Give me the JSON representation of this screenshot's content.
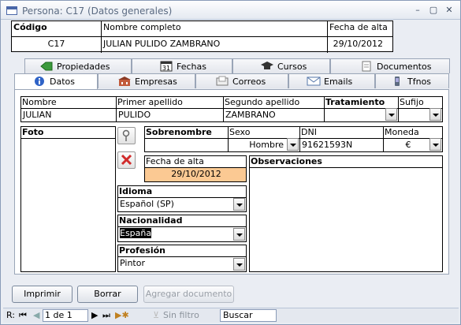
{
  "window": {
    "title": "Persona: C17 (Datos generales)",
    "controls": [
      "–",
      "▢",
      "✕"
    ]
  },
  "header": {
    "codigo_label": "Código",
    "codigo_value": "C17",
    "nombre_label": "Nombre completo",
    "nombre_value": "JULIAN PULIDO ZAMBRANO",
    "fecha_label": "Fecha de alta",
    "fecha_value": "29/10/2012"
  },
  "tabs_top": [
    {
      "label": "Propiedades",
      "icon": "tag-icon"
    },
    {
      "label": "Fechas",
      "icon": "calendar-icon",
      "badge": "31"
    },
    {
      "label": "Cursos",
      "icon": "graduation-cap-icon"
    },
    {
      "label": "Documentos",
      "icon": "document-icon"
    }
  ],
  "tabs_bottom": [
    {
      "label": "Datos",
      "icon": "info-icon"
    },
    {
      "label": "Empresas",
      "icon": "building-icon"
    },
    {
      "label": "Correos",
      "icon": "mail-tray-icon"
    },
    {
      "label": "Emails",
      "icon": "envelope-icon"
    },
    {
      "label": "Tfnos",
      "icon": "phone-icon"
    }
  ],
  "form": {
    "nombre_label": "Nombre",
    "nombre_value": "JULIAN",
    "apellido1_label": "Primer apellido",
    "apellido1_value": "PULIDO",
    "apellido2_label": "Segundo apellido",
    "apellido2_value": "ZAMBRANO",
    "tratamiento_label": "Tratamiento",
    "tratamiento_value": "",
    "sufijo_label": "Sufijo",
    "sufijo_value": "",
    "foto_label": "Foto",
    "sobrenombre_label": "Sobrenombre",
    "sobrenombre_value": "",
    "sexo_label": "Sexo",
    "sexo_value": "Hombre",
    "dni_label": "DNI",
    "dni_value": "91621593N",
    "moneda_label": "Moneda",
    "moneda_value": "€",
    "fecha_alta_label": "Fecha de alta",
    "fecha_alta_value": "29/10/2012",
    "observaciones_label": "Observaciones",
    "observaciones_value": "",
    "idioma_label": "Idioma",
    "idioma_value": "Español (SP)",
    "nacionalidad_label": "Nacionalidad",
    "nacionalidad_value": "España",
    "profesion_label": "Profesión",
    "profesion_value": "Pintor"
  },
  "buttons": {
    "imprimir": "Imprimir",
    "borrar": "Borrar",
    "agregar": "Agregar documento"
  },
  "navbar": {
    "record_prefix": "R:",
    "record_value": "1 de 1",
    "filter_label": "Sin filtro",
    "search_label": "Buscar"
  },
  "colors": {
    "fecha_alta_bg": "#fbc993",
    "window_bg": "#eaedf3"
  }
}
